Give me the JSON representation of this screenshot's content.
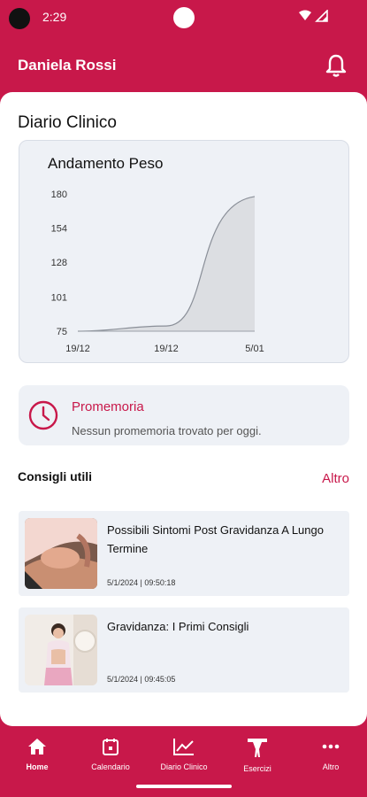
{
  "status": {
    "time": "2:29"
  },
  "header": {
    "user_name": "Daniela Rossi"
  },
  "clinical": {
    "title": "Diario Clinico"
  },
  "chart_data": {
    "type": "area",
    "title": "Andamento Peso",
    "x_labels": [
      "19/12",
      "19/12",
      "5/01"
    ],
    "yticks": [
      75,
      101,
      128,
      154,
      180
    ],
    "ylim": [
      75,
      180
    ],
    "values": [
      75,
      79,
      178
    ],
    "grid": false,
    "fill_color": "#dcdee2",
    "line_color": "#8a8f98"
  },
  "reminder": {
    "title": "Promemoria",
    "text": "Nessun promemoria trovato per oggi."
  },
  "tips": {
    "title": "Consigli utili",
    "more": "Altro",
    "articles": [
      {
        "title": "Possibili Sintomi Post Gravidanza A Lungo Termine",
        "date": "5/1/2024 | 09:50:18"
      },
      {
        "title": "Gravidanza: I Primi Consigli",
        "date": "5/1/2024 | 09:45:05"
      }
    ]
  },
  "nav": {
    "items": [
      {
        "label": "Home",
        "icon": "home-icon"
      },
      {
        "label": "Calendario",
        "icon": "calendar-icon"
      },
      {
        "label": "Diario Clinico",
        "icon": "chart-icon"
      },
      {
        "label": "Esercizi",
        "icon": "fitness-icon"
      },
      {
        "label": "Altro",
        "icon": "more-icon"
      }
    ]
  },
  "colors": {
    "brand": "#c8184a",
    "card": "#eef1f6"
  }
}
